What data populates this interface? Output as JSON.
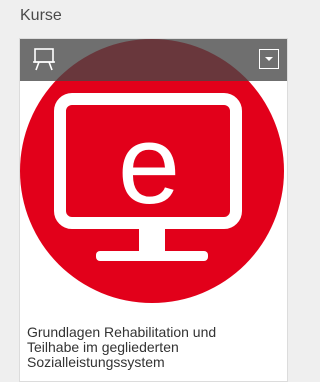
{
  "section": {
    "title": "Kurse"
  },
  "course_card": {
    "type_icon": "presentation-board-icon",
    "image_icon": "e-learning-monitor-icon",
    "image_letter": "e",
    "menu_icon": "chevron-down-icon",
    "title_line1": "Grundlagen Rehabilitation und",
    "title_line2": "Teilhabe im gegliederten",
    "title_line3": "Sozialleistungssystem"
  },
  "colors": {
    "accent_red": "#e2001a",
    "toolbar": "#464646",
    "background": "#efefef"
  }
}
